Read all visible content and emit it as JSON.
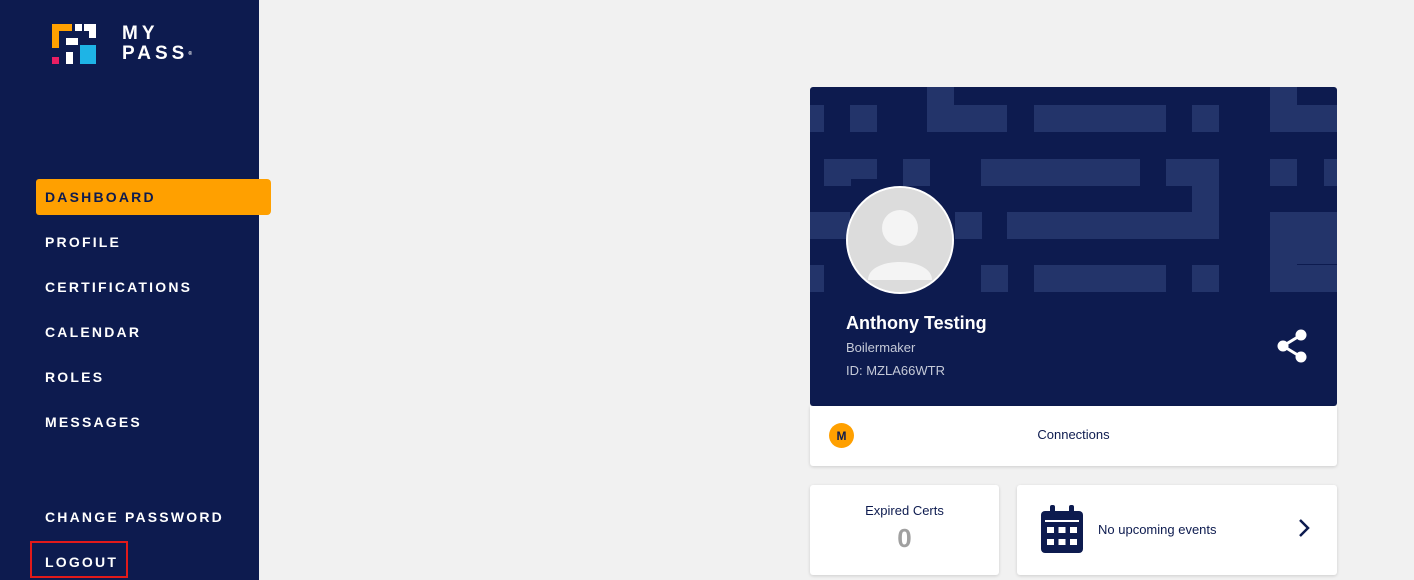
{
  "brand": {
    "line1": "MY",
    "line2": "PASS",
    "mark": "®"
  },
  "nav": {
    "dashboard": "DASHBOARD",
    "profile": "PROFILE",
    "certifications": "CERTIFICATIONS",
    "calendar": "CALENDAR",
    "roles": "ROLES",
    "messages": "MESSAGES",
    "change_password": "CHANGE PASSWORD",
    "logout": "LOGOUT"
  },
  "profile": {
    "name": "Anthony Testing",
    "occupation": "Boilermaker",
    "id": "ID: MZLA66WTR"
  },
  "connections": {
    "badge": "M",
    "label": "Connections"
  },
  "expired": {
    "label": "Expired Certs",
    "value": "0"
  },
  "calendar": {
    "label": "No upcoming events"
  },
  "icons": {
    "logo": "mypass-logo-icon",
    "avatar": "user-avatar-icon",
    "share": "share-icon",
    "calendar": "calendar-icon",
    "chevron": "chevron-right-icon"
  },
  "colors": {
    "navy": "#0d1b4f",
    "accent": "#ffa000",
    "highlight": "#e21a1a"
  }
}
